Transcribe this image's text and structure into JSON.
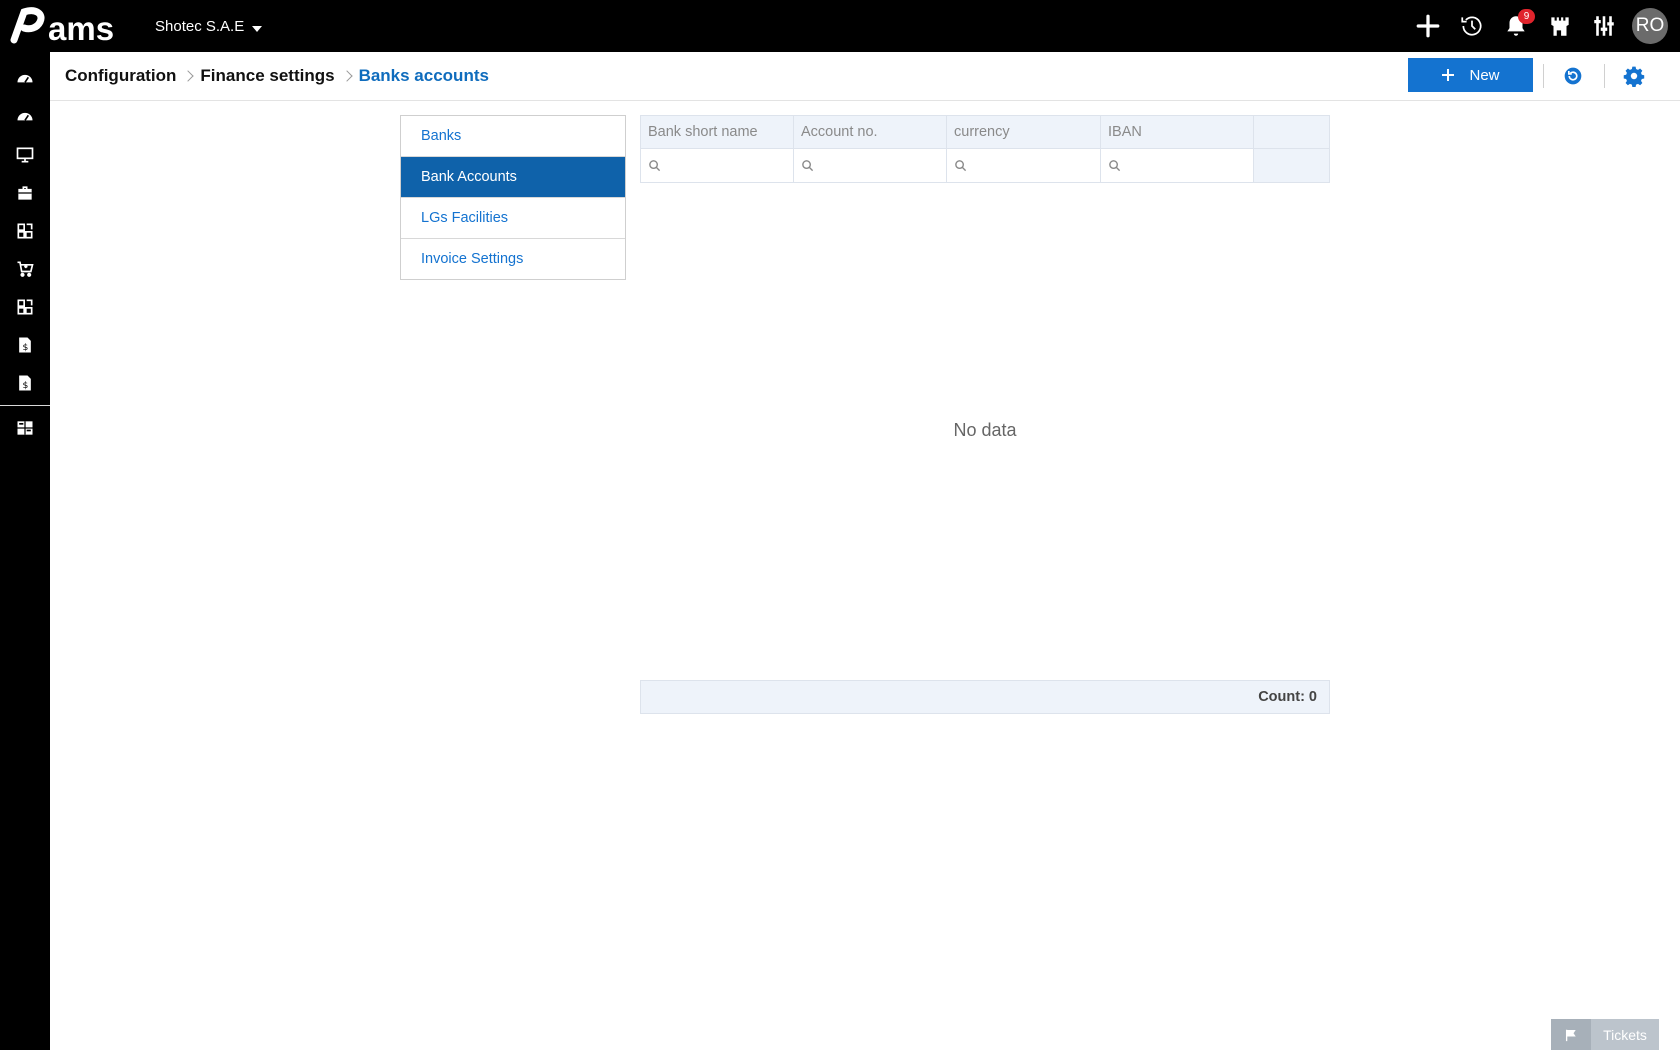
{
  "app": {
    "logo_text": "Pams"
  },
  "topbar": {
    "company": "Shotec S.A.E",
    "notifications_count": "9",
    "avatar_initials": "RO"
  },
  "breadcrumb": {
    "items": [
      "Configuration",
      "Finance settings",
      "Banks accounts"
    ]
  },
  "toolbar": {
    "new_label": "New"
  },
  "menu": {
    "items": [
      "Banks",
      "Bank Accounts",
      "LGs Facilities",
      "Invoice Settings"
    ],
    "active_index": 1
  },
  "grid": {
    "columns": [
      "Bank short name",
      "Account no.",
      "currency",
      "IBAN",
      ""
    ],
    "empty_text": "No data",
    "count_text": "Count: 0"
  },
  "tickets": {
    "label": "Tickets"
  },
  "colors": {
    "accent": "#1473d0",
    "active_menu": "#0f62aa",
    "topbar": "#000000"
  }
}
